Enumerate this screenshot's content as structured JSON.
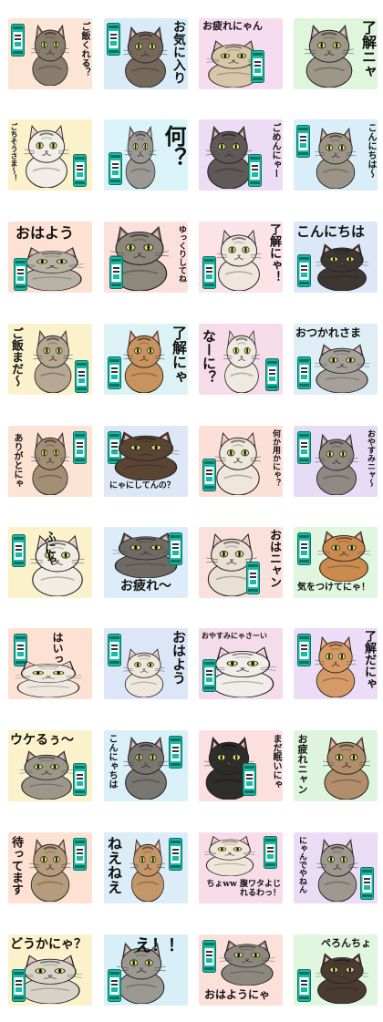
{
  "tiles": [
    {
      "bg": "#fde5d6",
      "fur": "#8a7d6e",
      "text": "ご飯くれる？"
    },
    {
      "bg": "#d7ecf7",
      "fur": "#76695c",
      "text": "お気に入り"
    },
    {
      "bg": "#f7dcef",
      "fur": "#d8c6a8",
      "text": "お疲れにゃん"
    },
    {
      "bg": "#dff5dc",
      "fur": "#9d9788",
      "text": "了解ニャ"
    },
    {
      "bg": "#fbf2cc",
      "fur": "#f2ede6",
      "text": "ごちそうさま〜！"
    },
    {
      "bg": "#d9f3f8",
      "fur": "#9c9893",
      "text": "何？"
    },
    {
      "bg": "#ecdcf4",
      "fur": "#5f5a58",
      "text": "ごめんにゃー"
    },
    {
      "bg": "#d9eef8",
      "fur": "#9c9486",
      "text": "こんにちは〜"
    },
    {
      "bg": "#fde1d2",
      "fur": "#b9b2a6",
      "text": "おはよう"
    },
    {
      "bg": "#fce0dc",
      "fur": "#8e877b",
      "text": "ゆっくりしてね"
    },
    {
      "bg": "#fbe3e8",
      "fur": "#efe7dd",
      "text": "了解にゃ！"
    },
    {
      "bg": "#dce8f7",
      "fur": "#3d3632",
      "text": "こんにちは"
    },
    {
      "bg": "#fbf2cc",
      "fur": "#b7a894",
      "text": "ご飯まだ〜"
    },
    {
      "bg": "#dcf2f5",
      "fur": "#c8935e",
      "text": "了解にゃ"
    },
    {
      "bg": "#f6dde9",
      "fur": "#efe9e2",
      "text": "なーに？"
    },
    {
      "bg": "#dfeef6",
      "fur": "#a5a19a",
      "text": "おつかれさま"
    },
    {
      "bg": "#fde3d4",
      "fur": "#a48e74",
      "text": "ありがとにゃ"
    },
    {
      "bg": "#dde7f6",
      "fur": "#5a4433",
      "text": "にゃにしてんの？"
    },
    {
      "bg": "#fce0d8",
      "fur": "#efe6dc",
      "text": "何か用かにゃ？"
    },
    {
      "bg": "#e7dcf5",
      "fur": "#8e8983",
      "text": "おやすみニャ〜"
    },
    {
      "bg": "#fbf2cc",
      "fur": "#f1ede5",
      "text": "ふにゃ"
    },
    {
      "bg": "#dcecf8",
      "fur": "#6f6a64",
      "text": "お疲れ〜"
    },
    {
      "bg": "#fbe0dc",
      "fur": "#e9dfd2",
      "text": "おはニャン"
    },
    {
      "bg": "#e0f6df",
      "fur": "#cb8a4e",
      "text": "気をつけてにゃ！"
    },
    {
      "bg": "#fde1d2",
      "fur": "#efe8df",
      "text": "はいっ！"
    },
    {
      "bg": "#dce6f7",
      "fur": "#efe7dc",
      "text": "おはよう"
    },
    {
      "bg": "#f4dcea",
      "fur": "#f1ede8",
      "text": "おやすみにゃさーい"
    },
    {
      "bg": "#eddcf6",
      "fur": "#d69a66",
      "text": "了解だにゃ"
    },
    {
      "bg": "#fbf2cc",
      "fur": "#9d968b",
      "text": "ウケるぅ〜"
    },
    {
      "bg": "#d9f0f8",
      "fur": "#7a7670",
      "text": "こんにゃちは"
    },
    {
      "bg": "#fce0e0",
      "fur": "#2f2d2c",
      "text": "まだ眠いにゃ"
    },
    {
      "bg": "#dff4dd",
      "fur": "#b38e6c",
      "text": "お疲れニャン"
    },
    {
      "bg": "#fde1d2",
      "fur": "#b69c7c",
      "text": "待ってます"
    },
    {
      "bg": "#dcedf8",
      "fur": "#c59669",
      "text": "ねえねえ"
    },
    {
      "bg": "#f8dde9",
      "fur": "#efe5d8",
      "text": "ちょww 腹ワタよじれるわっ！"
    },
    {
      "bg": "#ebdcf6",
      "fur": "#9e9890",
      "text": "にゃんでやねん"
    },
    {
      "bg": "#fbf2cc",
      "fur": "#d8d2c8",
      "text": "どうかにゃ？"
    },
    {
      "bg": "#d9eff8",
      "fur": "#9b9892",
      "text": "え！！"
    },
    {
      "bg": "#fde0da",
      "fur": "#8c877f",
      "text": "おはようにゃ"
    },
    {
      "bg": "#e0f6df",
      "fur": "#4a3b30",
      "text": "ぺろんちょ"
    }
  ]
}
